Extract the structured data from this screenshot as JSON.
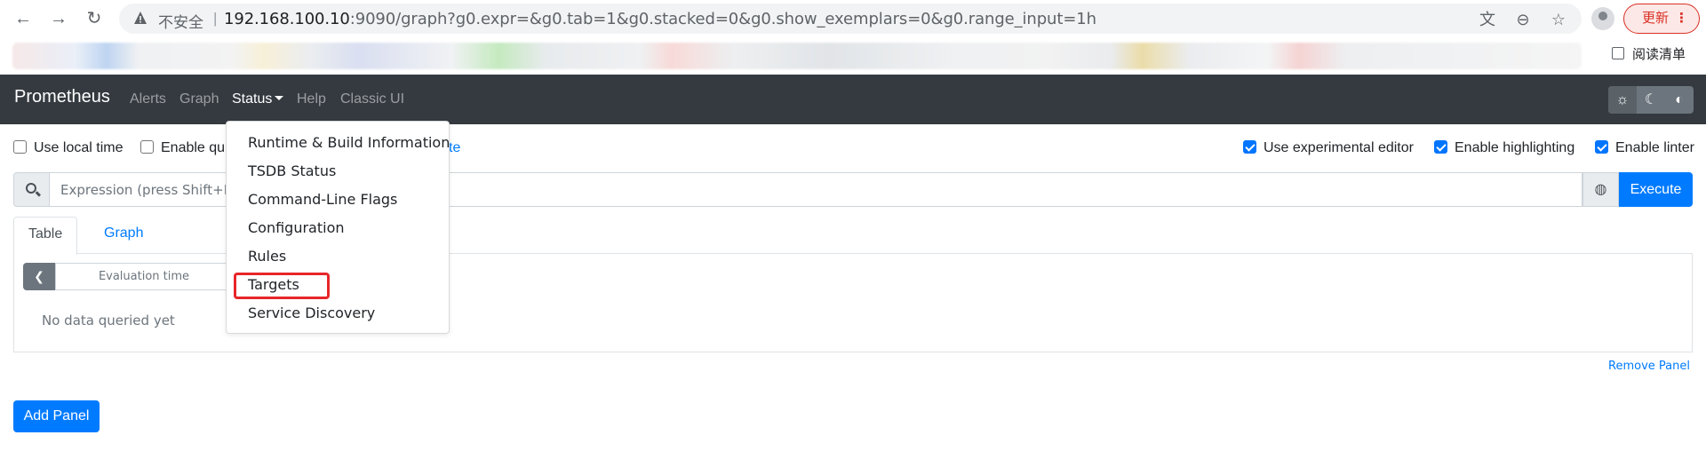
{
  "browser": {
    "insecure_label": "不安全",
    "separator": "|",
    "url_host": "192.168.100.10",
    "url_rest": ":9090/graph?g0.expr=&g0.tab=1&g0.stacked=0&g0.show_exemplars=0&g0.range_input=1h",
    "update_label": "更新",
    "reading_list_label": "阅读清单"
  },
  "navbar": {
    "brand": "Prometheus",
    "links": [
      "Alerts",
      "Graph",
      "Status",
      "Help",
      "Classic UI"
    ]
  },
  "options": {
    "use_local_time": "Use local time",
    "enable_query_history": "Enable qu",
    "hidden_link_fragment": "te",
    "use_experimental_editor": "Use experimental editor",
    "enable_highlighting": "Enable highlighting",
    "enable_linter": "Enable linter"
  },
  "expression": {
    "placeholder": "Expression (press Shift+Ente",
    "execute_label": "Execute"
  },
  "tabs": [
    "Table",
    "Graph"
  ],
  "panel": {
    "eval_time_placeholder": "Evaluation time",
    "no_data": "No data queried yet",
    "remove_label": "Remove Panel"
  },
  "add_panel_label": "Add Panel",
  "status_menu": {
    "items": [
      "Runtime & Build Information",
      "TSDB Status",
      "Command-Line Flags",
      "Configuration",
      "Rules",
      "Targets",
      "Service Discovery"
    ],
    "highlighted": "Targets"
  },
  "colors": {
    "navbar_bg": "#343a40",
    "primary": "#007bff",
    "highlight_red": "#e8262a"
  }
}
